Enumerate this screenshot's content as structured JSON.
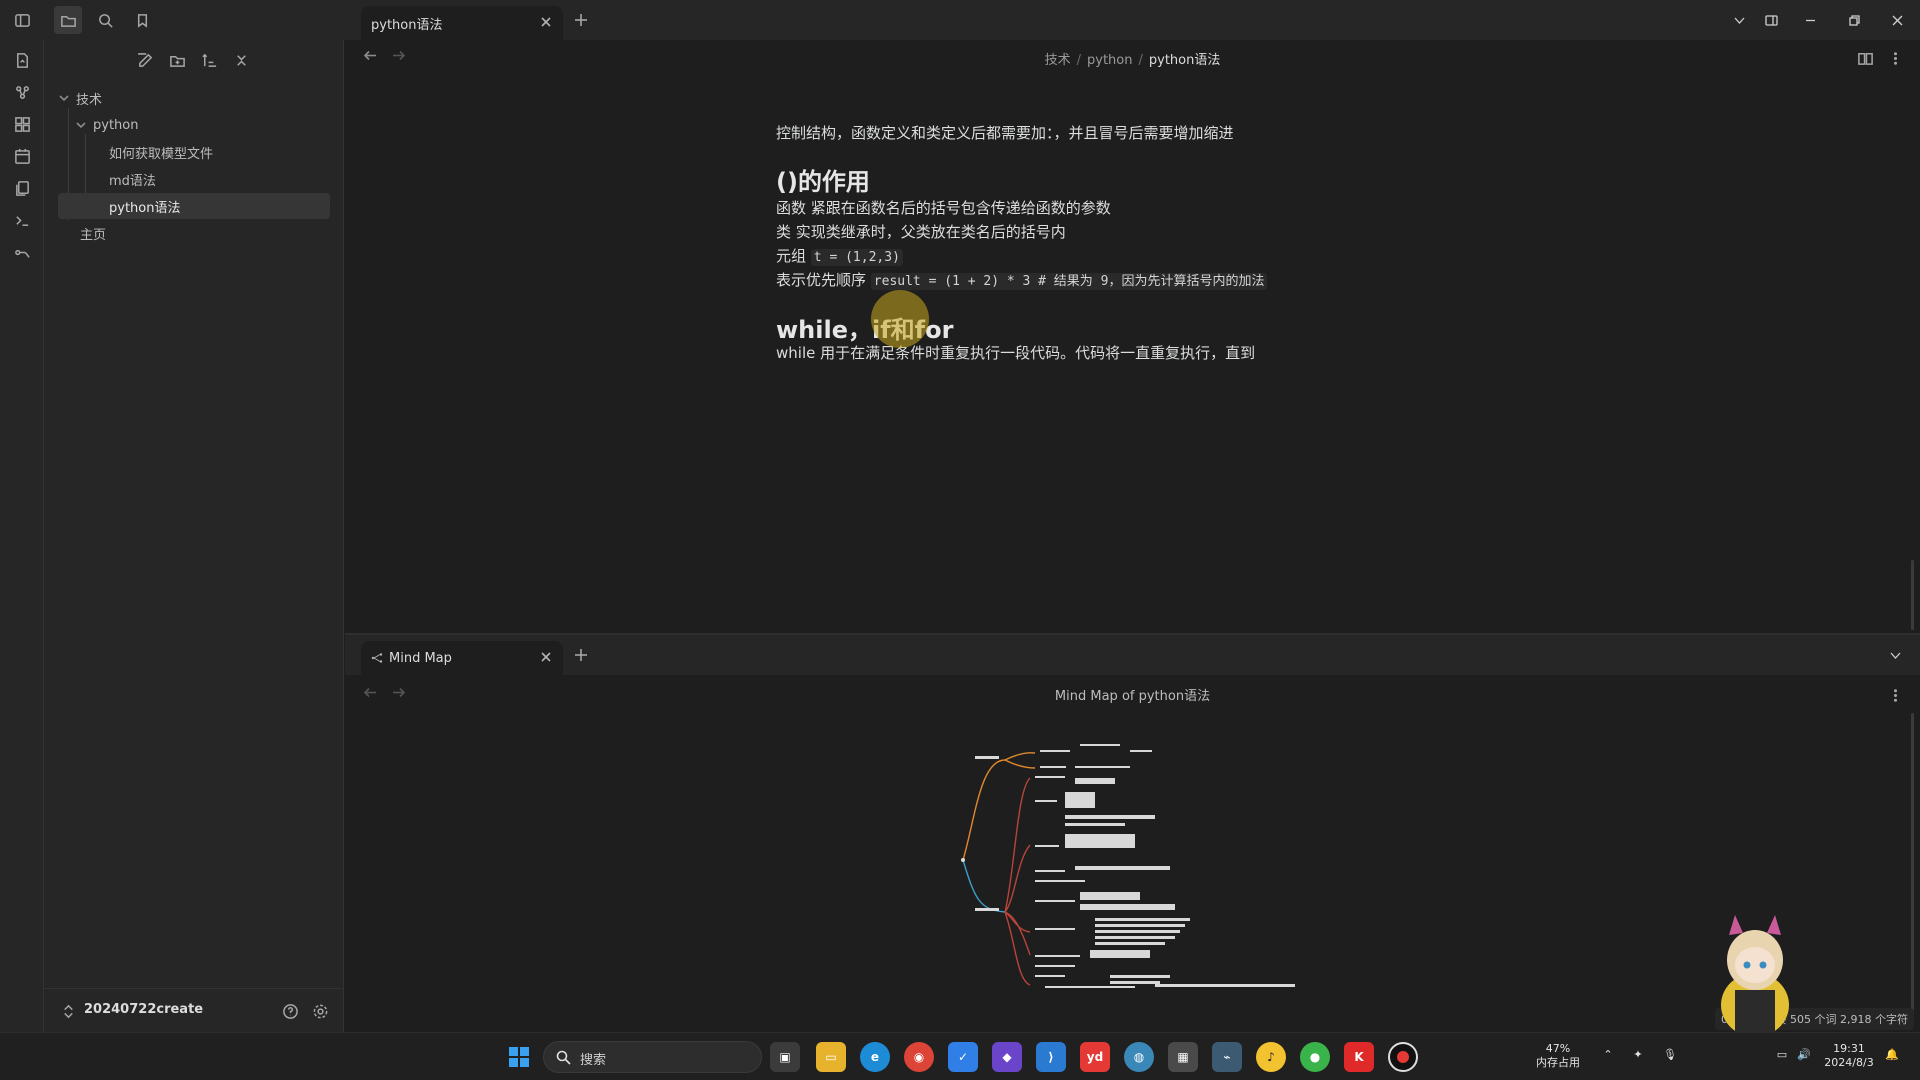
{
  "tabs": [
    {
      "label": "python语法"
    }
  ],
  "breadcrumb": {
    "part1": "技术",
    "part2": "python",
    "current": "python语法"
  },
  "tree": {
    "folder_root": "技术",
    "folder_python": "python",
    "files": [
      "如何获取模型文件",
      "md语法",
      "python语法"
    ],
    "root_file": "主页"
  },
  "vault": {
    "name": "20240722create"
  },
  "doc": {
    "line_intro": "控制结构，函数定义和类定义后都需要加：，并且冒号后需要增加缩进",
    "h_parens": "()的作用",
    "p_func": "函数 紧跟在函数名后的括号包含传递给函数的参数",
    "p_class": "类 实现类继承时，父类放在类名后的括号内",
    "p_tuple_label": "元组",
    "p_tuple_code": "t = (1,2,3)",
    "p_prec_label": "表示优先顺序",
    "p_prec_code": "result = (1 + 2) * 3  # 结果为 9，因为先计算括号内的加法",
    "h_loops": "while，if和for",
    "p_while": "while 用于在满足条件时重复执行一段代码。代码将一直重复执行，直到"
  },
  "mindmap": {
    "tab_label": "Mind Map",
    "title": "Mind Map of python语法"
  },
  "status": {
    "text": "0 条反向链接  505 个词  2,918 个字符"
  },
  "taskbar": {
    "search_label": "搜索",
    "mem_percent": "47%",
    "mem_label": "内存占用",
    "time": "19:31",
    "date": "2024/8/3"
  },
  "colors": {
    "accent": "#c8aa1e",
    "mindmap_orange": "#e0892c",
    "mindmap_blue": "#3a9fc9",
    "mindmap_red": "#b8443a"
  }
}
